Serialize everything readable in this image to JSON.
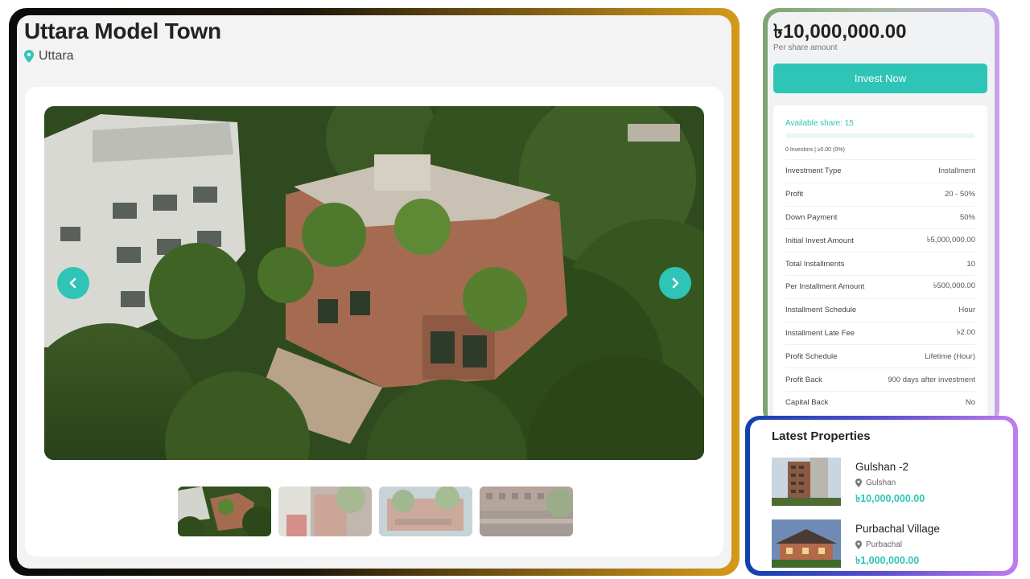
{
  "property": {
    "title": "Uttara Model Town",
    "location": "Uttara"
  },
  "gallery": {
    "main_image_icon": "building-photo",
    "prev_icon": "chevron-left-icon",
    "next_icon": "chevron-right-icon",
    "thumbnail_count": 4,
    "active_thumbnail": 1
  },
  "invest": {
    "price": "৳10,000,000.00",
    "price_caption": "Per share amount",
    "button_label": "Invest Now",
    "available_share": "Available share: 15",
    "progress_fraction": 0,
    "investors_summary": "0 Investors | ৳0.00 (0%)",
    "details": [
      {
        "label": "Investment Type",
        "value": "Installment"
      },
      {
        "label": "Profit",
        "value": "20 - 50%"
      },
      {
        "label": "Down Payment",
        "value": "50%"
      },
      {
        "label": "Initial Invest Amount",
        "value": "৳5,000,000.00"
      },
      {
        "label": "Total Installments",
        "value": "10"
      },
      {
        "label": "Per Installment Amount",
        "value": "৳500,000.00"
      },
      {
        "label": "Installment Schedule",
        "value": "Hour"
      },
      {
        "label": "Installment Late Fee",
        "value": "৳2.00"
      },
      {
        "label": "Profit Schedule",
        "value": "Lifetime (Hour)"
      },
      {
        "label": "Profit Back",
        "value": "900 days after investment"
      },
      {
        "label": "Capital Back",
        "value": "No"
      }
    ]
  },
  "latest": {
    "title": "Latest Properties",
    "items": [
      {
        "name": "Gulshan -2",
        "location": "Gulshan",
        "price": "৳10,000,000.00"
      },
      {
        "name": "Purbachal Village",
        "location": "Purbachal",
        "price": "৳1,000,000.00"
      }
    ]
  },
  "colors": {
    "accent": "#2ec4b6",
    "left_frame_gradient": [
      "#0b0b0b",
      "#d49a1a"
    ],
    "invest_frame_gradient": [
      "#7da470",
      "#c7a4ee"
    ],
    "latest_frame_gradient": [
      "#123fb0",
      "#c27bf0"
    ]
  }
}
